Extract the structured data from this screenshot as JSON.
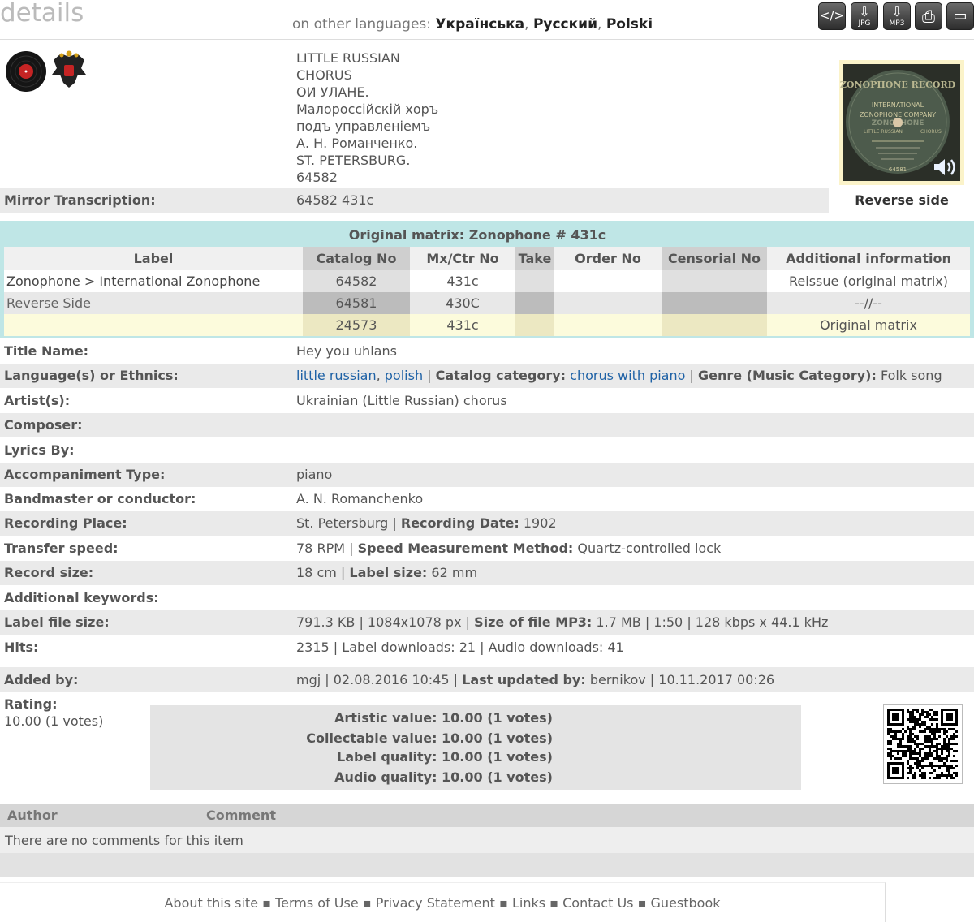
{
  "header": {
    "title": "details",
    "other_languages_label": "on other languages:",
    "languages": [
      "Українська",
      "Русский",
      "Polski"
    ],
    "toolbar": {
      "embed_label": "</>",
      "jpg_label": "JPG",
      "mp3_label": "MP3",
      "print_label": "",
      "card_label": ""
    }
  },
  "record": {
    "label_text_lines": [
      "LITTLE RUSSIAN",
      "CHORUS",
      "ОИ УЛАНЕ.",
      "Малороссійскій хоръ",
      "подъ управленіемъ",
      "А. Н. Романченко.",
      "ST. PETERSBURG.",
      "64582"
    ],
    "mirror_transcription_label": "Mirror Transcription:",
    "mirror_transcription_value": "64582 431c",
    "reverse_side_label": "Reverse side",
    "disc_image_text": [
      "ZONOPHONE RECORD",
      "INTERNATIONAL",
      "ZONOPHONE COMPANY",
      "ZONOPHONE",
      "LITTLE RUSSIAN",
      "CHORUS",
      "64581"
    ]
  },
  "matrix": {
    "title": "Original matrix: Zonophone # 431c",
    "columns": [
      "Label",
      "Catalog No",
      "Mx/Ctr No",
      "Take",
      "Order No",
      "Censorial No",
      "Additional information"
    ],
    "rows": [
      [
        "Zonophone > International Zonophone",
        "64582",
        "431c",
        "",
        "",
        "",
        "Reissue (original matrix)"
      ],
      [
        "Reverse Side",
        "64581",
        "430C",
        "",
        "",
        "",
        "--//--"
      ],
      [
        "",
        "24573",
        "431c",
        "",
        "",
        "",
        "Original matrix"
      ]
    ]
  },
  "details": {
    "title_name_label": "Title Name:",
    "title_name": "Hey you uhlans",
    "language_label": "Language(s) or Ethnics:",
    "languages": [
      "little russian",
      "polish"
    ],
    "catalog_category_label": "Catalog category:",
    "catalog_category": "chorus with piano",
    "genre_label": "Genre (Music Category):",
    "genre": "Folk song",
    "artist_label": "Artist(s):",
    "artist": "Ukrainian (Little Russian) chorus",
    "composer_label": "Composer:",
    "lyrics_label": "Lyrics By:",
    "accompaniment_label": "Accompaniment Type:",
    "accompaniment": "piano",
    "bandmaster_label": "Bandmaster or conductor:",
    "bandmaster": "A. N. Romanchenko",
    "recording_place_label": "Recording Place:",
    "recording_place": "St. Petersburg",
    "recording_date_label": "Recording Date:",
    "recording_date": "1902",
    "transfer_speed_label": "Transfer speed:",
    "transfer_speed": "78 RPM",
    "speed_method_label": "Speed Measurement Method:",
    "speed_method": "Quartz-controlled lock",
    "record_size_label": "Record size:",
    "record_size": "18 cm",
    "label_size_label": "Label size:",
    "label_size": "62 mm",
    "keywords_label": "Additional keywords:",
    "label_file_size_label": "Label file size:",
    "label_file_size": "791.3 KB | 1084x1078 px",
    "mp3_size_label": "Size of file MP3:",
    "mp3_size": "1.7 MB | 1:50 | 128 kbps x 44.1 kHz",
    "hits_label": "Hits:",
    "hits": "2315 | Label downloads: 21 | Audio downloads: 41",
    "added_by_label": "Added by:",
    "added_by": "mgj | 02.08.2016 10:45",
    "updated_by_label": "Last updated by:",
    "updated_by": " bernikov | 10.11.2017 00:26"
  },
  "rating": {
    "label": "Rating:",
    "value": "10.00 (1 votes)",
    "artistic": "Artistic value: 10.00 (1 votes)",
    "collectable": "Collectable value: 10.00 (1 votes)",
    "label_quality": "Label quality: 10.00 (1 votes)",
    "audio_quality": "Audio quality: 10.00 (1 votes)"
  },
  "comments": {
    "author_header": "Author",
    "comment_header": "Comment",
    "empty_text": "There are no comments for this item"
  },
  "footer": {
    "links": [
      "About this site",
      "Terms of Use",
      "Privacy Statement",
      "Links",
      "Contact Us",
      "Guestbook"
    ]
  }
}
